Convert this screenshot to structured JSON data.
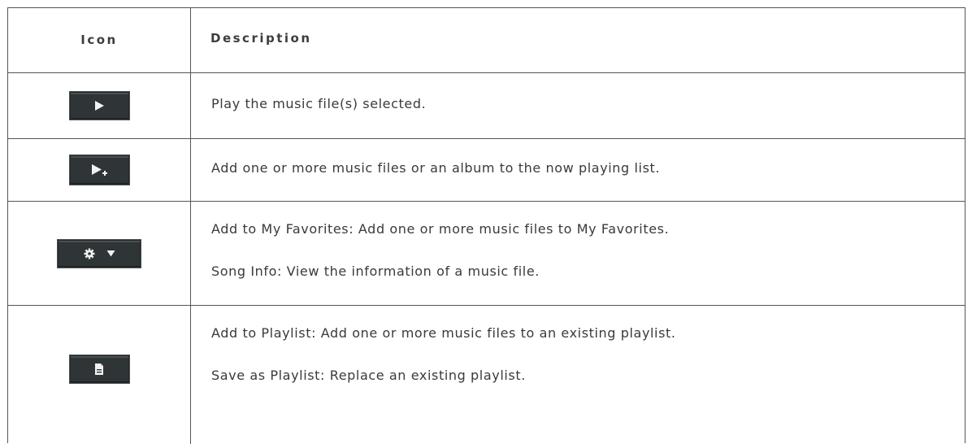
{
  "table": {
    "headers": {
      "icon": "Icon",
      "description": "Description"
    },
    "rows": [
      {
        "icon": "play-icon",
        "lines": [
          "Play the music file(s) selected."
        ]
      },
      {
        "icon": "play-add-icon",
        "lines": [
          "Add one or more music files or an album to the now playing list."
        ]
      },
      {
        "icon": "gear-dropdown-icon",
        "lines": [
          "Add to My Favorites: Add one or more music files to My Favorites.",
          "Song Info: View the information of a music file."
        ]
      },
      {
        "icon": "playlist-document-icon",
        "lines": [
          "Add to Playlist: Add one or more music files to an existing playlist.",
          "Save as Playlist: Replace an existing playlist."
        ]
      }
    ]
  }
}
